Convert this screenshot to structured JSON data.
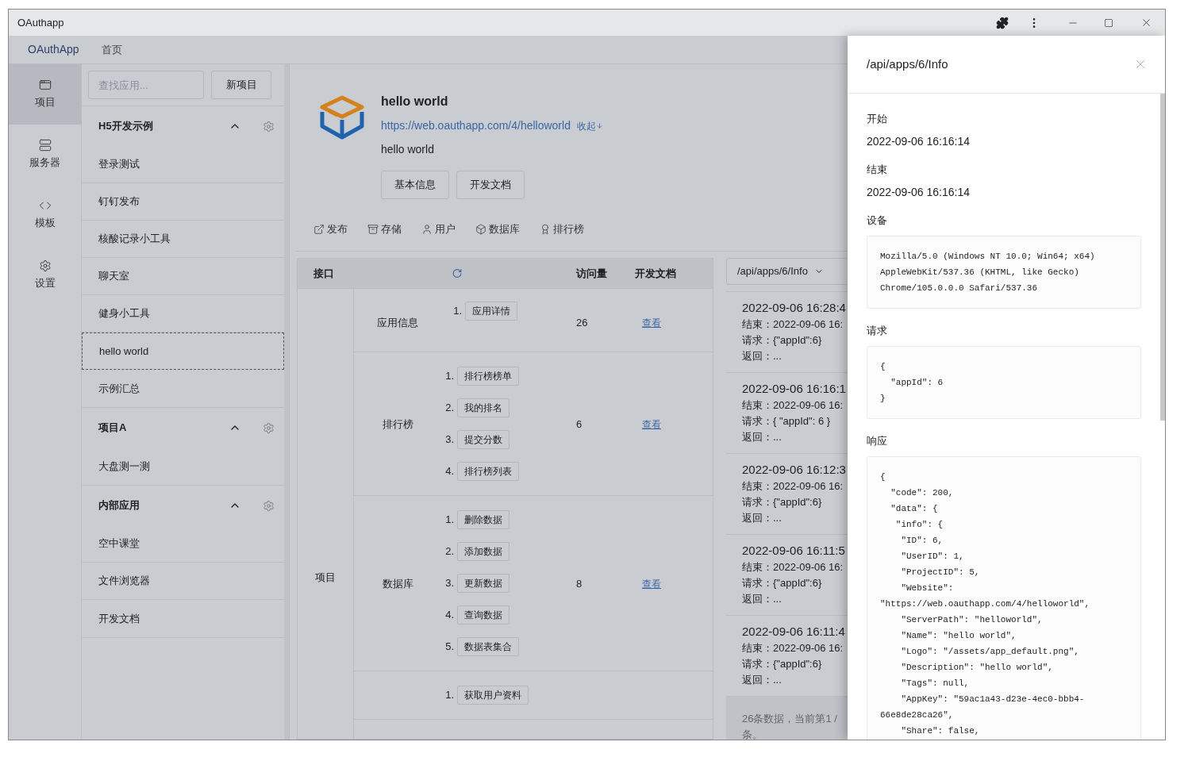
{
  "window": {
    "title": "OAuthapp"
  },
  "nav": [
    {
      "label": "OAuthApp",
      "selected": true
    },
    {
      "label": "首页",
      "selected": false
    }
  ],
  "rail": [
    {
      "label": "项目",
      "selected": true
    },
    {
      "label": "服务器",
      "selected": false
    },
    {
      "label": "模板",
      "selected": false
    },
    {
      "label": "设置",
      "selected": false
    }
  ],
  "search": {
    "placeholder": "查找应用..."
  },
  "new_button": "新项目",
  "groups": [
    {
      "title": "H5开发示例",
      "expanded": true,
      "apps": [
        {
          "name": "登录测试",
          "selected": false
        },
        {
          "name": "钉钉发布",
          "selected": false
        },
        {
          "name": "核酸记录小工具",
          "selected": false
        },
        {
          "name": "聊天室",
          "selected": false
        },
        {
          "name": "健身小工具",
          "selected": false
        },
        {
          "name": "hello world",
          "selected": true
        },
        {
          "name": "示例汇总",
          "selected": false
        }
      ]
    },
    {
      "title": "项目A",
      "expanded": true,
      "apps": [
        {
          "name": "大盘测一测",
          "selected": false
        }
      ]
    },
    {
      "title": "内部应用",
      "expanded": true,
      "apps": [
        {
          "name": "空中课堂",
          "selected": false
        },
        {
          "name": "文件浏览器",
          "selected": false
        },
        {
          "name": "开发文档",
          "selected": false
        }
      ]
    }
  ],
  "app": {
    "name": "hello world",
    "url": "https://web.oauthapp.com/4/helloworld",
    "toggle": "收起",
    "description": "hello world",
    "buttons": [
      "基本信息",
      "开发文档"
    ]
  },
  "tabs": [
    {
      "label": "发布",
      "kind": "publish"
    },
    {
      "label": "存储",
      "kind": "storage"
    },
    {
      "label": "用户",
      "kind": "user"
    },
    {
      "label": "数据库",
      "kind": "database"
    },
    {
      "label": "排行榜",
      "kind": "ranking"
    }
  ],
  "api_table": {
    "columns": [
      "接口",
      "访问量",
      "开发文档"
    ],
    "category": "项目",
    "groups": [
      {
        "name": "应用信息",
        "methods": [
          {
            "number": "1.",
            "label": "应用详情"
          }
        ],
        "visits": "26",
        "doc": "查看"
      },
      {
        "name": "排行榜",
        "methods": [
          {
            "number": "1.",
            "label": "排行榜榜单"
          },
          {
            "number": "2.",
            "label": "我的排名"
          },
          {
            "number": "3.",
            "label": "提交分数"
          },
          {
            "number": "4.",
            "label": "排行榜列表"
          }
        ],
        "visits": "6",
        "doc": "查看"
      },
      {
        "name": "数据库",
        "methods": [
          {
            "number": "1.",
            "label": "删除数据"
          },
          {
            "number": "2.",
            "label": "添加数据"
          },
          {
            "number": "3.",
            "label": "更新数据"
          },
          {
            "number": "4.",
            "label": "查询数据"
          },
          {
            "number": "5.",
            "label": "数据表集合"
          }
        ],
        "visits": "8",
        "doc": "查看"
      },
      {
        "methods": [
          {
            "number": "1.",
            "label": "获取用户资料"
          }
        ]
      }
    ]
  },
  "logs": {
    "filter": "/api/apps/6/Info",
    "items": [
      {
        "time": "2022-09-06 16:28:4",
        "end": "结束：2022-09-06 16:",
        "request": "请求：{\"appId\":6}",
        "result": "返回：..."
      },
      {
        "time": "2022-09-06 16:16:1",
        "end": "结束：2022-09-06 16:",
        "request": "请求：{ \"appId\": 6 }",
        "result": "返回：..."
      },
      {
        "time": "2022-09-06 16:12:3",
        "end": "结束：2022-09-06 16:",
        "request": "请求：{\"appId\":6}",
        "result": "返回：..."
      },
      {
        "time": "2022-09-06 16:11:5",
        "end": "结束：2022-09-06 16:",
        "request": "请求：{\"appId\":6}",
        "result": "返回：..."
      },
      {
        "time": "2022-09-06 16:11:4",
        "end": "结束：2022-09-06 16:",
        "request": "请求：{\"appId\":6}",
        "result": "返回：..."
      }
    ],
    "footer": [
      "26条数据，当前第1 /",
      "条。"
    ]
  },
  "drawer": {
    "title": "/api/apps/6/Info",
    "sections": [
      {
        "label": "开始",
        "kind": "text",
        "lines": [
          "2022-09-06 16:16:14"
        ]
      },
      {
        "label": "结束",
        "kind": "text",
        "lines": [
          "2022-09-06 16:16:14"
        ]
      },
      {
        "label": "设备",
        "kind": "code",
        "lines": [
          "Mozilla/5.0 (Windows NT 10.0; Win64; x64)",
          "AppleWebKit/537.36 (KHTML, like Gecko)",
          "Chrome/105.0.0.0 Safari/537.36"
        ]
      },
      {
        "label": "请求",
        "kind": "code",
        "lines": [
          "{",
          "  \"appId\": 6",
          "}"
        ]
      },
      {
        "label": "响应",
        "kind": "code",
        "lines": [
          "{",
          "  \"code\": 200,",
          "  \"data\": {",
          "   \"info\": {",
          "    \"ID\": 6,",
          "    \"UserID\": 1,",
          "    \"ProjectID\": 5,",
          "    \"Website\":",
          "\"https://web.oauthapp.com/4/helloworld\",",
          "    \"ServerPath\": \"helloworld\",",
          "    \"Name\": \"hello world\",",
          "    \"Logo\": \"/assets/app_default.png\",",
          "    \"Description\": \"hello world\",",
          "    \"Tags\": null,",
          "    \"AppKey\": \"59ac1a43-d23e-4ec0-bbb4-",
          "66e8de28ca26\",",
          "    \"Share\": false,"
        ]
      }
    ]
  }
}
